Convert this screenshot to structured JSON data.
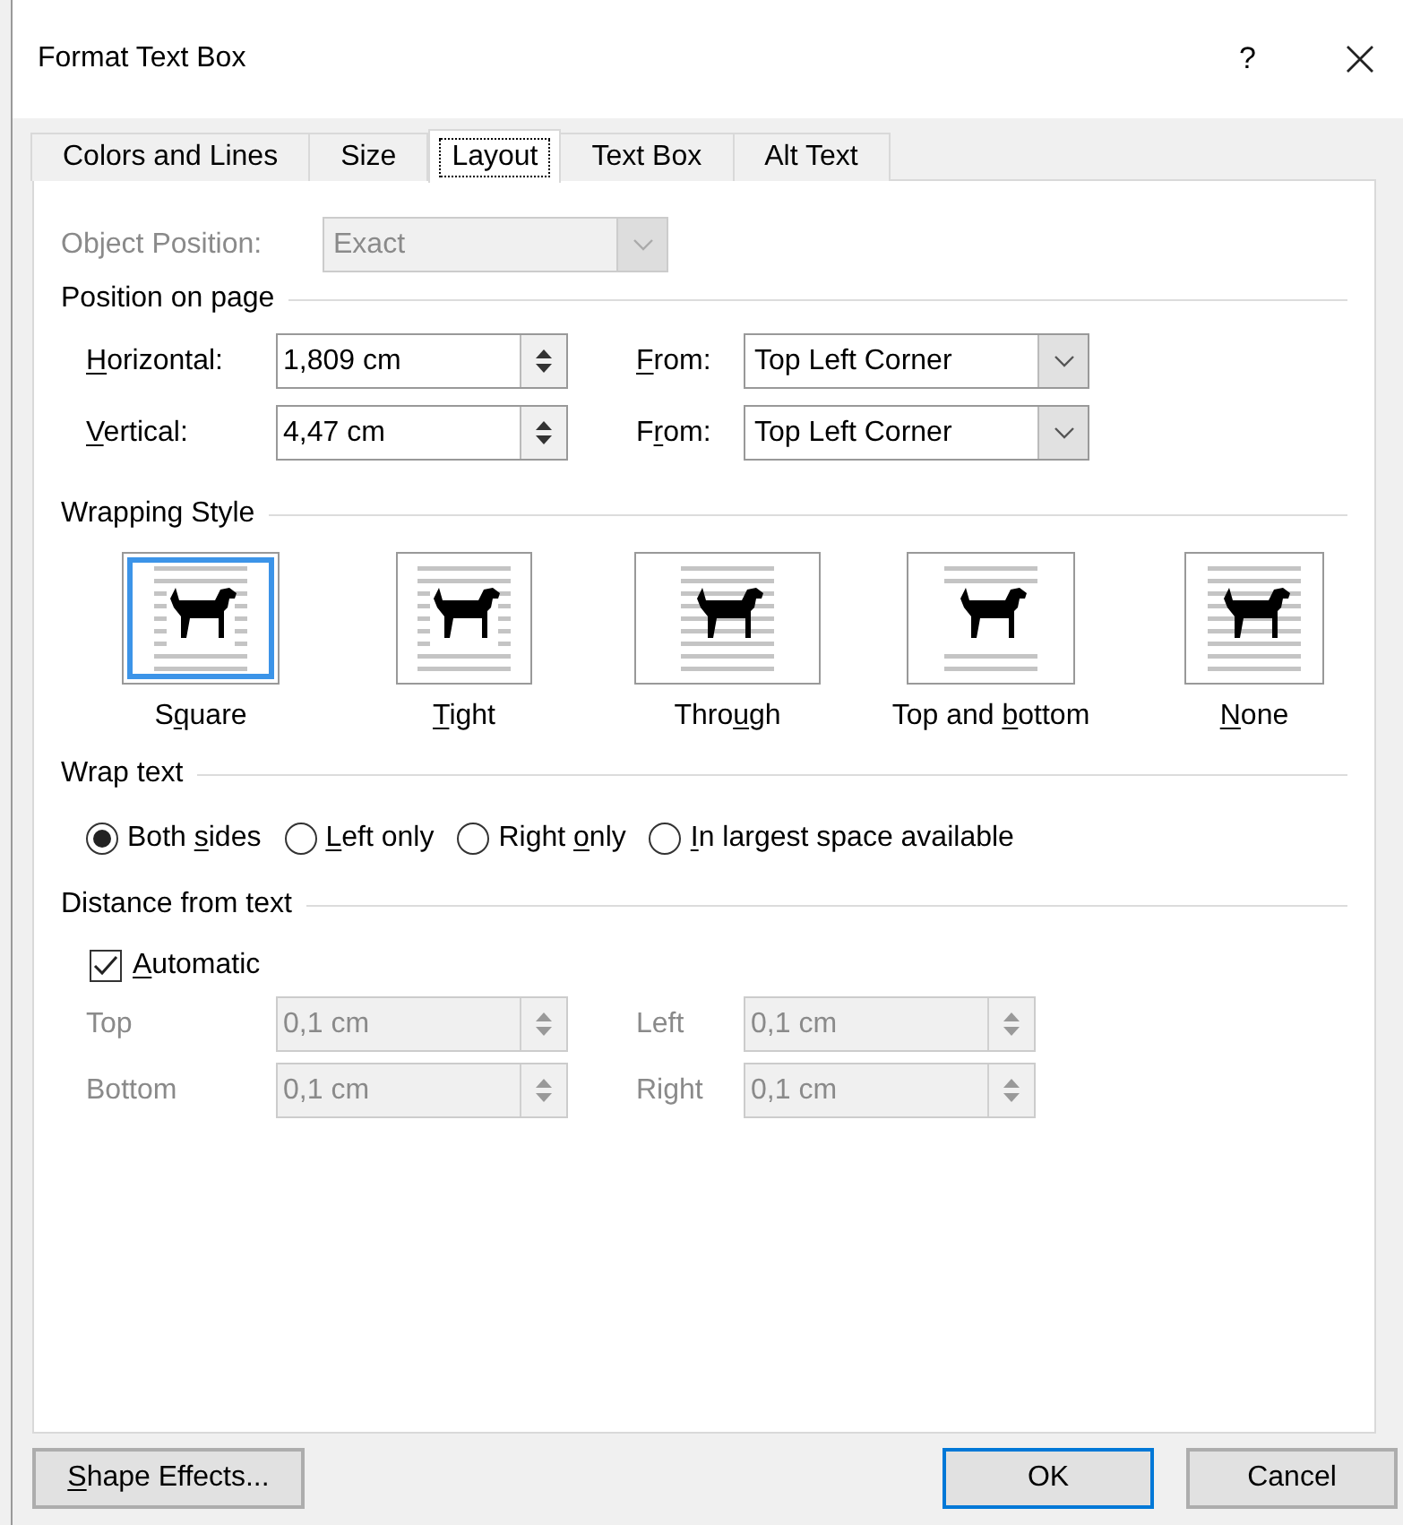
{
  "window": {
    "title": "Format Text Box",
    "help": "?"
  },
  "tabs": [
    {
      "label": "Colors and Lines",
      "selected": false
    },
    {
      "label": "Size",
      "selected": false
    },
    {
      "label": "Layout",
      "selected": true
    },
    {
      "label": "Text Box",
      "selected": false
    },
    {
      "label": "Alt Text",
      "selected": false
    }
  ],
  "object_position": {
    "label": "Object Position:",
    "value": "Exact",
    "disabled": true
  },
  "position_on_page": {
    "title": "Position on page",
    "rows": [
      {
        "label": {
          "key": "H",
          "post": "orizontal:"
        },
        "value": "1,809 cm",
        "from_label": {
          "key": "F",
          "post": "rom:"
        },
        "from_value": "Top Left Corner"
      },
      {
        "label": {
          "key": "V",
          "post": "ertical:"
        },
        "value": "4,47 cm",
        "from_label": {
          "pre": "F",
          "key": "r",
          "post": "om:"
        },
        "from_value": "Top Left Corner"
      }
    ]
  },
  "wrapping_style": {
    "title": "Wrapping Style",
    "options": [
      {
        "label": {
          "pre": "S",
          "key": "q",
          "post": "uare"
        },
        "kind": "square",
        "selected": true
      },
      {
        "label": {
          "key": "T",
          "post": "ight"
        },
        "kind": "tight",
        "selected": false
      },
      {
        "label": {
          "pre": "Thro",
          "key": "u",
          "post": "gh"
        },
        "kind": "through",
        "selected": false
      },
      {
        "label": {
          "pre": "Top and ",
          "key": "b",
          "post": "ottom"
        },
        "kind": "topbottom",
        "selected": false
      },
      {
        "label": {
          "key": "N",
          "post": "one"
        },
        "kind": "none",
        "selected": false
      }
    ]
  },
  "wrap_text": {
    "title": "Wrap text",
    "options": [
      {
        "label": {
          "pre": "Both ",
          "key": "s",
          "post": "ides"
        },
        "selected": true
      },
      {
        "label": {
          "key": "L",
          "post": "eft only"
        },
        "selected": false
      },
      {
        "label": {
          "pre": "Right ",
          "key": "o",
          "post": "nly"
        },
        "selected": false
      },
      {
        "label": {
          "key": "I",
          "post": "n largest space available"
        },
        "selected": false
      }
    ]
  },
  "distance_from_text": {
    "title": "Distance from text",
    "automatic": {
      "label": {
        "key": "A",
        "post": "utomatic"
      },
      "checked": true
    },
    "fields": [
      {
        "label": "Top",
        "value": "0,1 cm",
        "disabled": true
      },
      {
        "label": "Left",
        "value": "0,1 cm",
        "disabled": true
      },
      {
        "label": "Bottom",
        "value": "0,1 cm",
        "disabled": true
      },
      {
        "label": "Right",
        "value": "0,1 cm",
        "disabled": true
      }
    ]
  },
  "buttons": [
    {
      "label": {
        "key": "S",
        "post": "hape Effects..."
      },
      "default": false
    },
    {
      "label": "OK",
      "default": true
    },
    {
      "label": "Cancel",
      "default": false
    }
  ]
}
